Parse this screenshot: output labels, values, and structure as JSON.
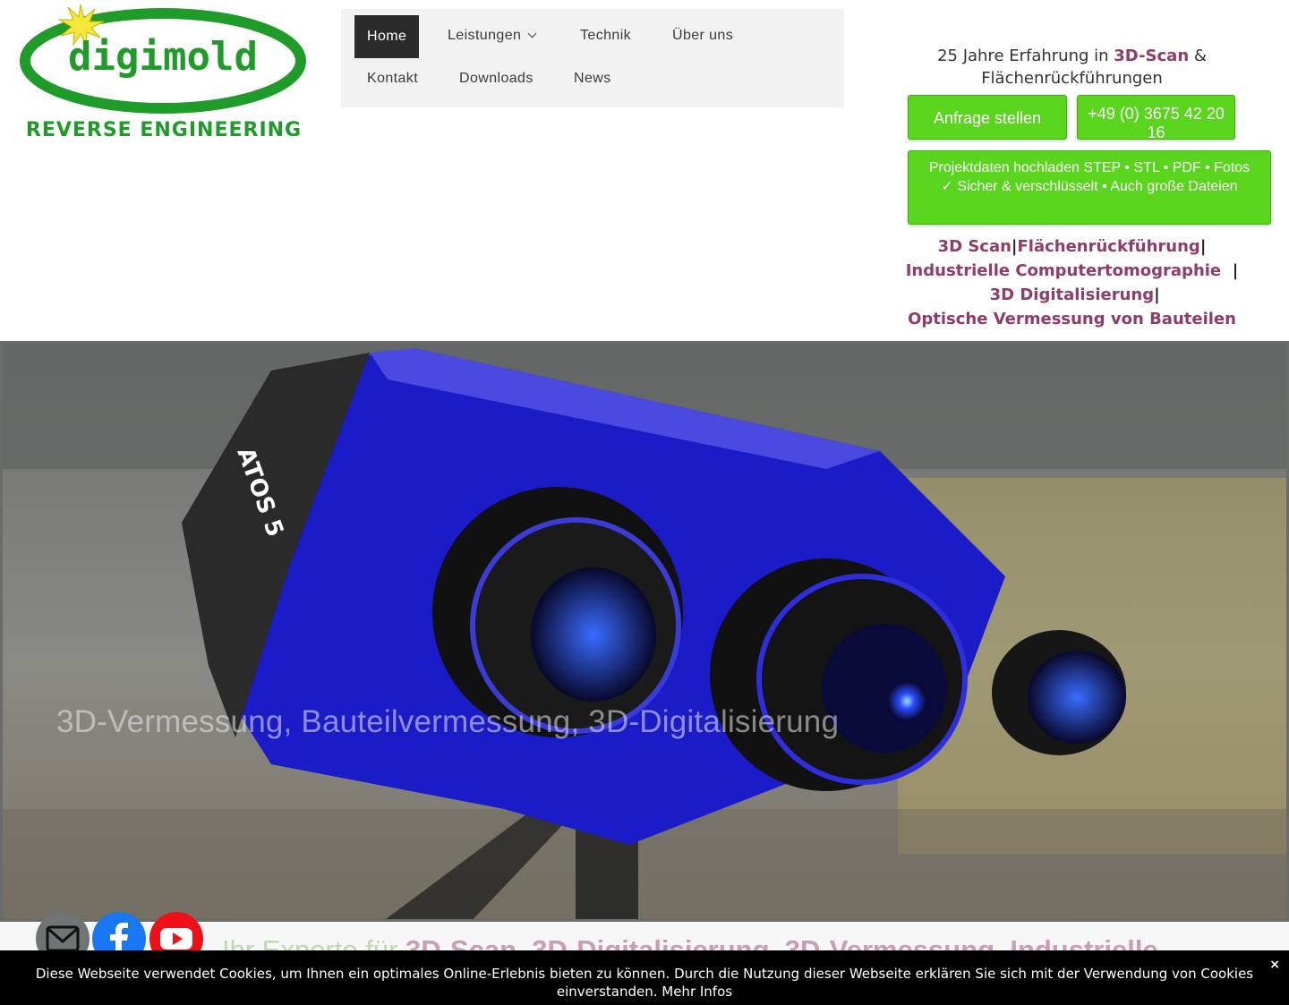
{
  "logo": {
    "name": "digimold",
    "tagline": "REVERSE ENGINEERING"
  },
  "nav": {
    "row1": [
      "Home",
      "Leistungen",
      "Technik",
      "Über uns"
    ],
    "row2": [
      "Kontakt",
      "Downloads",
      "News"
    ]
  },
  "header_right": {
    "experience_pre": "25 Jahre Erfahrung in ",
    "experience_link": "3D-Scan",
    "experience_post": " & Flächenrückführungen",
    "anfrage_label": "Anfrage stellen",
    "phone_label": "+49 (0) 3675 42 20 16",
    "upload_label": " Projektdaten hochladen STEP • STL • PDF • Fotos ✓ Sicher & verschlüsselt • Auch große Dateien",
    "links": [
      "3D Scan",
      "Flächenrückführung",
      "Industrielle Computertomographie",
      "3D Digitalisierung",
      "Optische Vermessung von Bauteilen"
    ],
    "separator": "|"
  },
  "hero": {
    "title": "3D-Vermessung, Bauteilvermessung, 3D-Digitalisierung",
    "scanner_label": "ATOS 5"
  },
  "section": {
    "heading_pre": "Ihr Experte für ",
    "heading_bold": "3D-Scan, 3D-Digitalisierung, 3D-Vermessung, Industrielle"
  },
  "social": [
    "mail-icon",
    "facebook-icon",
    "youtube-icon"
  ],
  "cookie": {
    "text": "Diese Webseite verwendet Cookies, um Ihnen ein optimales Online-Erlebnis bieten zu können. Durch die Nutzung dieser Webseite erklären Sie sich mit der Verwendung von Cookies einverstanden. ",
    "more_link": "Mehr Infos",
    "close": "×"
  },
  "colors": {
    "accent": "#8e3c6a",
    "green": "#5ad51e",
    "nav_active": "#2b2b2b"
  }
}
